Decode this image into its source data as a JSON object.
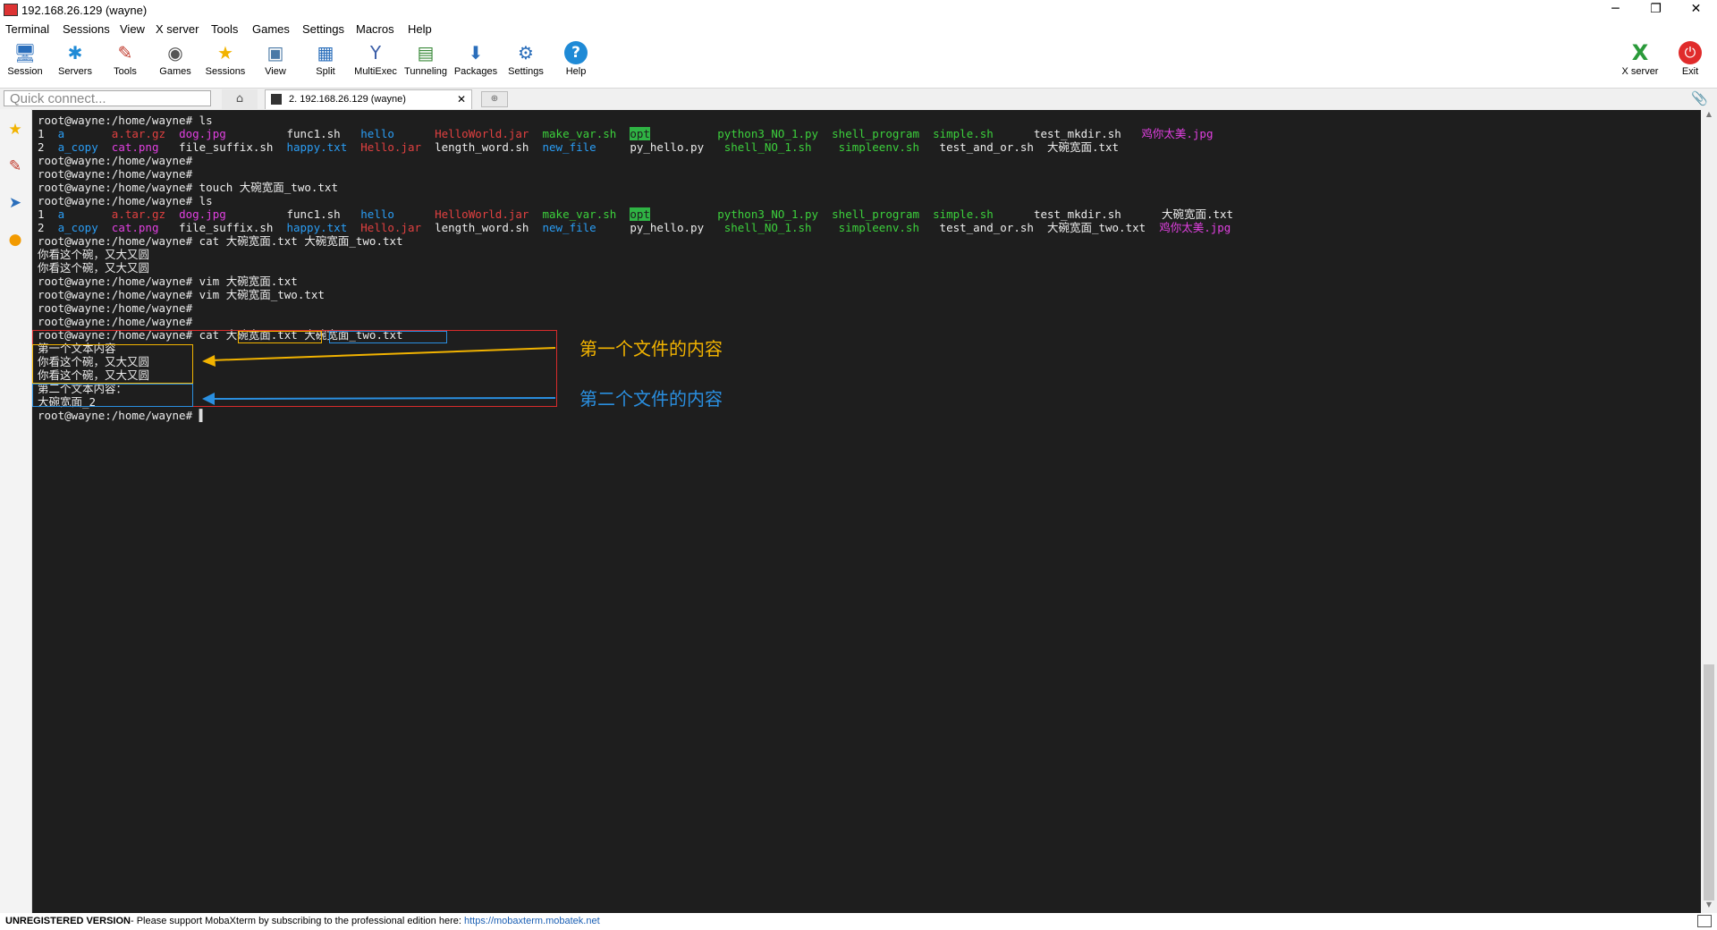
{
  "window": {
    "title": "192.168.26.129 (wayne)",
    "controls": {
      "minimize": "─",
      "restore": "❐",
      "close": "✕"
    }
  },
  "menu": [
    "Terminal",
    "Sessions",
    "View",
    "X server",
    "Tools",
    "Games",
    "Settings",
    "Macros",
    "Help"
  ],
  "toolbar": {
    "left": [
      {
        "label": "Session",
        "icon": "session-icon",
        "glyph": "🖥",
        "color": "#2a6ebb"
      },
      {
        "label": "Servers",
        "icon": "servers-icon",
        "glyph": "✱",
        "color": "#1f8ad6"
      },
      {
        "label": "Tools",
        "icon": "tools-icon",
        "glyph": "✎",
        "color": "#c0392b"
      },
      {
        "label": "Games",
        "icon": "games-icon",
        "glyph": "◉",
        "color": "#555555"
      },
      {
        "label": "Sessions",
        "icon": "sessions-star-icon",
        "glyph": "★",
        "color": "#f2b300"
      },
      {
        "label": "View",
        "icon": "view-icon",
        "glyph": "▣",
        "color": "#4a79a6"
      },
      {
        "label": "Split",
        "icon": "split-icon",
        "glyph": "▦",
        "color": "#2a6ebb"
      },
      {
        "label": "MultiExec",
        "icon": "multiexec-icon",
        "glyph": "Y",
        "color": "#3c5fa8"
      },
      {
        "label": "Tunneling",
        "icon": "tunneling-icon",
        "glyph": "▤",
        "color": "#3a8a3a"
      },
      {
        "label": "Packages",
        "icon": "packages-icon",
        "glyph": "⬇",
        "color": "#2a6ebb"
      },
      {
        "label": "Settings",
        "icon": "settings-gear-icon",
        "glyph": "⚙",
        "color": "#2a6ebb"
      },
      {
        "label": "Help",
        "icon": "help-icon",
        "glyph": "?",
        "color": "#ffffff"
      }
    ],
    "right": [
      {
        "label": "X server",
        "icon": "x-server-icon",
        "glyph": "X",
        "color": "#2a9a3a"
      },
      {
        "label": "Exit",
        "icon": "exit-power-icon",
        "glyph": "⏻",
        "color": "#ffffff"
      }
    ]
  },
  "tabs": {
    "quick_connect_placeholder": "Quick connect...",
    "home_glyph": "⌂",
    "session_tab_label": "2. 192.168.26.129 (wayne)",
    "close_glyph": "✕",
    "new_tab_glyph": "⊕",
    "clip_glyph": "📎"
  },
  "sidebar_icons": [
    {
      "name": "sidebar-star-icon",
      "glyph": "★",
      "color": "#f2b300"
    },
    {
      "name": "sidebar-tools-icon",
      "glyph": "✎",
      "color": "#c0392b"
    },
    {
      "name": "sidebar-send-icon",
      "glyph": "➤",
      "color": "#2a6ebb"
    },
    {
      "name": "sidebar-macros-icon",
      "glyph": "●",
      "color": "#f29a00"
    }
  ],
  "terminal": {
    "lines": [
      {
        "segs": [
          {
            "t": "root@wayne:/home/wayne# ls"
          }
        ]
      },
      {
        "segs": [
          {
            "t": "1  "
          },
          {
            "t": "a",
            "c": "#2a9df4"
          },
          {
            "t": "       "
          },
          {
            "t": "a.tar.gz",
            "c": "#e04040"
          },
          {
            "t": "  "
          },
          {
            "t": "dog.jpg",
            "c": "#e040e0"
          },
          {
            "t": "         func1.sh   "
          },
          {
            "t": "hello",
            "c": "#2a9df4"
          },
          {
            "t": "      "
          },
          {
            "t": "HelloWorld.jar",
            "c": "#e04040"
          },
          {
            "t": "  "
          },
          {
            "t": "make_var.sh",
            "c": "#3cd03c"
          },
          {
            "t": "  "
          },
          {
            "t": "opt",
            "c": "#1e1e1e",
            "bg": "#2fb344"
          },
          {
            "t": "          "
          },
          {
            "t": "python3_NO_1.py",
            "c": "#3cd03c"
          },
          {
            "t": "  "
          },
          {
            "t": "shell_program",
            "c": "#3cd03c"
          },
          {
            "t": "  "
          },
          {
            "t": "simple.sh",
            "c": "#3cd03c"
          },
          {
            "t": "      test_mkdir.sh   "
          },
          {
            "t": "鸡你太美.jpg",
            "c": "#e040e0"
          }
        ]
      },
      {
        "segs": [
          {
            "t": "2  "
          },
          {
            "t": "a_copy",
            "c": "#2a9df4"
          },
          {
            "t": "  "
          },
          {
            "t": "cat.png",
            "c": "#e040e0"
          },
          {
            "t": "   file_suffix.sh  "
          },
          {
            "t": "happy.txt",
            "c": "#2a9df4"
          },
          {
            "t": "  "
          },
          {
            "t": "Hello.jar",
            "c": "#e04040"
          },
          {
            "t": "  length_word.sh  "
          },
          {
            "t": "new_file",
            "c": "#2a9df4"
          },
          {
            "t": "     py_hello.py   "
          },
          {
            "t": "shell_NO_1.sh",
            "c": "#3cd03c"
          },
          {
            "t": "    "
          },
          {
            "t": "simpleenv.sh",
            "c": "#3cd03c"
          },
          {
            "t": "   test_and_or.sh  大碗宽面.txt"
          }
        ]
      },
      {
        "segs": [
          {
            "t": "root@wayne:/home/wayne#"
          }
        ]
      },
      {
        "segs": [
          {
            "t": "root@wayne:/home/wayne#"
          }
        ]
      },
      {
        "segs": [
          {
            "t": "root@wayne:/home/wayne# touch 大碗宽面_two.txt"
          }
        ]
      },
      {
        "segs": [
          {
            "t": "root@wayne:/home/wayne# ls"
          }
        ]
      },
      {
        "segs": [
          {
            "t": "1  "
          },
          {
            "t": "a",
            "c": "#2a9df4"
          },
          {
            "t": "       "
          },
          {
            "t": "a.tar.gz",
            "c": "#e04040"
          },
          {
            "t": "  "
          },
          {
            "t": "dog.jpg",
            "c": "#e040e0"
          },
          {
            "t": "         func1.sh   "
          },
          {
            "t": "hello",
            "c": "#2a9df4"
          },
          {
            "t": "      "
          },
          {
            "t": "HelloWorld.jar",
            "c": "#e04040"
          },
          {
            "t": "  "
          },
          {
            "t": "make_var.sh",
            "c": "#3cd03c"
          },
          {
            "t": "  "
          },
          {
            "t": "opt",
            "c": "#1e1e1e",
            "bg": "#2fb344"
          },
          {
            "t": "          "
          },
          {
            "t": "python3_NO_1.py",
            "c": "#3cd03c"
          },
          {
            "t": "  "
          },
          {
            "t": "shell_program",
            "c": "#3cd03c"
          },
          {
            "t": "  "
          },
          {
            "t": "simple.sh",
            "c": "#3cd03c"
          },
          {
            "t": "      test_mkdir.sh      大碗宽面.txt"
          }
        ]
      },
      {
        "segs": [
          {
            "t": "2  "
          },
          {
            "t": "a_copy",
            "c": "#2a9df4"
          },
          {
            "t": "  "
          },
          {
            "t": "cat.png",
            "c": "#e040e0"
          },
          {
            "t": "   file_suffix.sh  "
          },
          {
            "t": "happy.txt",
            "c": "#2a9df4"
          },
          {
            "t": "  "
          },
          {
            "t": "Hello.jar",
            "c": "#e04040"
          },
          {
            "t": "  length_word.sh  "
          },
          {
            "t": "new_file",
            "c": "#2a9df4"
          },
          {
            "t": "     py_hello.py   "
          },
          {
            "t": "shell_NO_1.sh",
            "c": "#3cd03c"
          },
          {
            "t": "    "
          },
          {
            "t": "simpleenv.sh",
            "c": "#3cd03c"
          },
          {
            "t": "   test_and_or.sh  大碗宽面_two.txt  "
          },
          {
            "t": "鸡你太美.jpg",
            "c": "#e040e0"
          }
        ]
      },
      {
        "segs": [
          {
            "t": "root@wayne:/home/wayne# cat 大碗宽面.txt 大碗宽面_two.txt"
          }
        ]
      },
      {
        "segs": [
          {
            "t": "你看这个碗，又大又圆"
          }
        ]
      },
      {
        "segs": [
          {
            "t": "你看这个碗，又大又圆"
          }
        ]
      },
      {
        "segs": [
          {
            "t": "root@wayne:/home/wayne# vim 大碗宽面.txt"
          }
        ]
      },
      {
        "segs": [
          {
            "t": "root@wayne:/home/wayne# vim 大碗宽面_two.txt"
          }
        ]
      },
      {
        "segs": [
          {
            "t": "root@wayne:/home/wayne#"
          }
        ]
      },
      {
        "segs": [
          {
            "t": "root@wayne:/home/wayne#"
          }
        ]
      },
      {
        "segs": [
          {
            "t": "root@wayne:/home/wayne# cat 大碗宽面.txt 大碗宽面_two.txt"
          }
        ]
      },
      {
        "segs": [
          {
            "t": "第一个文本内容"
          }
        ]
      },
      {
        "segs": [
          {
            "t": "你看这个碗，又大又圆"
          }
        ]
      },
      {
        "segs": [
          {
            "t": "你看这个碗，又大又圆"
          }
        ]
      },
      {
        "segs": [
          {
            "t": "第二个文本内容："
          }
        ]
      },
      {
        "segs": [
          {
            "t": "大碗宽面_2"
          }
        ]
      },
      {
        "segs": [
          {
            "t": "root@wayne:/home/wayne# "
          },
          {
            "t": "▌",
            "c": "#dddddd"
          }
        ]
      }
    ]
  },
  "annotations": {
    "first": {
      "text": "第一个文件的内容",
      "color": "#f2b300"
    },
    "second": {
      "text": "第二个文件的内容",
      "color": "#2a8fe0"
    },
    "outline_color": "#d92b2b"
  },
  "status": {
    "unregistered": "UNREGISTERED VERSION",
    "message": " -  Please support MobaXterm by subscribing to the professional edition here: ",
    "link": "https://mobaxterm.mobatek.net"
  }
}
